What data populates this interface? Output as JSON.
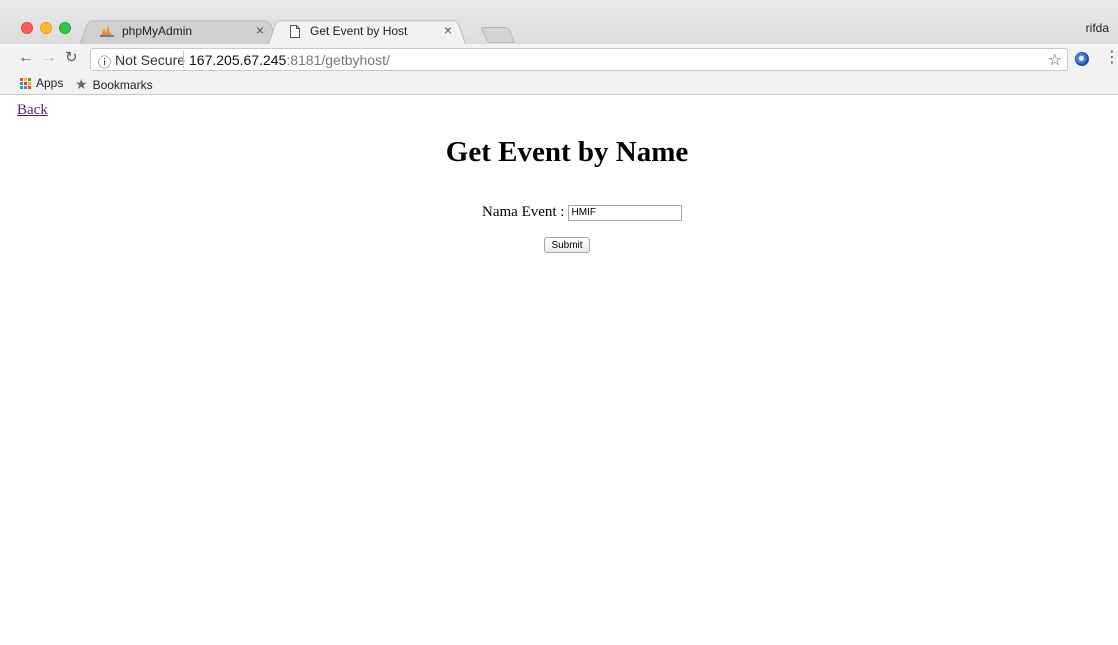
{
  "browser": {
    "tabs": [
      {
        "title": "phpMyAdmin",
        "icon": "phpmyadmin-icon",
        "active": false
      },
      {
        "title": "Get Event by Host",
        "icon": "page-icon",
        "active": true
      }
    ],
    "tab_close_glyph": "×",
    "profile_name": "rifda",
    "address": {
      "security_label": "Not Secure",
      "host": "167.205.67.245",
      "path": ":8181/getbyhost/"
    },
    "bookmarks": {
      "apps_label": "Apps",
      "bookmarks_label": "Bookmarks"
    },
    "colors": {
      "apps_grid": [
        "#ea4335",
        "#fbbc05",
        "#34a853",
        "#4285f4",
        "#ea4335",
        "#fbbc05",
        "#34a853",
        "#4285f4",
        "#ea4335"
      ]
    }
  },
  "page": {
    "back_link": "Back",
    "heading": "Get Event by Name",
    "form": {
      "label": "Nama Event :",
      "input_value": "HMIF",
      "submit_label": "Submit"
    },
    "colors": {
      "visited_link": "#551a8b"
    }
  }
}
